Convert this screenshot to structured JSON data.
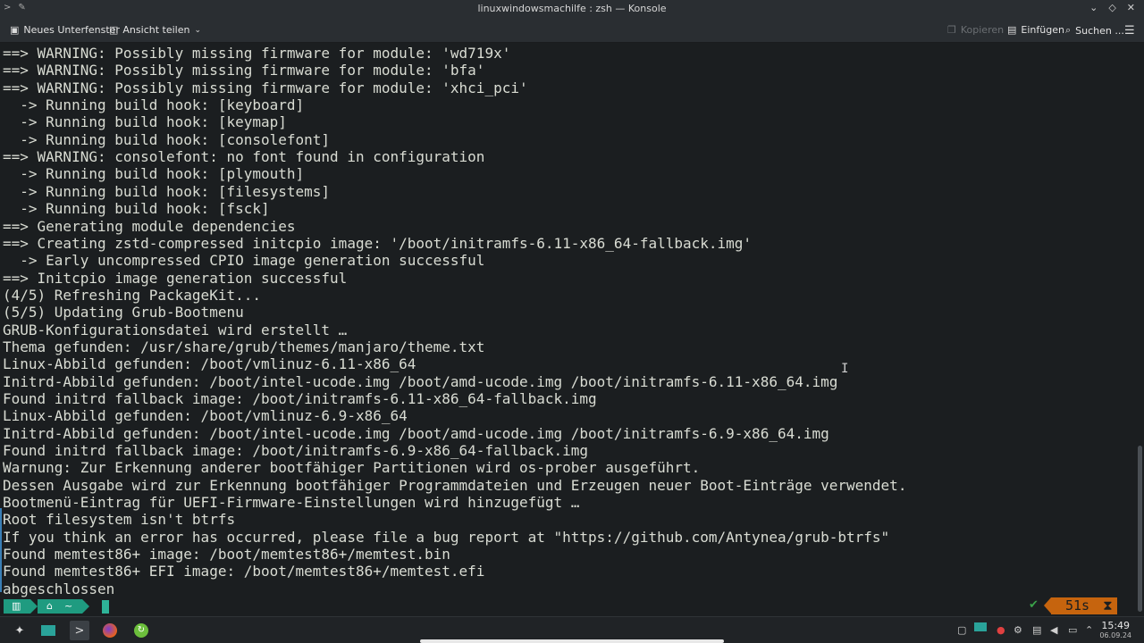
{
  "window": {
    "title": "linuxwindowsmachilfe : zsh — Konsole"
  },
  "toolbar": {
    "new_tab": "Neues Unterfenster",
    "split_view": "Ansicht teilen",
    "copy": "Kopieren",
    "paste": "Einfügen",
    "search": "Suchen ..."
  },
  "terminal": {
    "lines": [
      "==> WARNING: Possibly missing firmware for module: 'wd719x'",
      "==> WARNING: Possibly missing firmware for module: 'bfa'",
      "==> WARNING: Possibly missing firmware for module: 'xhci_pci'",
      "  -> Running build hook: [keyboard]",
      "  -> Running build hook: [keymap]",
      "  -> Running build hook: [consolefont]",
      "==> WARNING: consolefont: no font found in configuration",
      "  -> Running build hook: [plymouth]",
      "  -> Running build hook: [filesystems]",
      "  -> Running build hook: [fsck]",
      "==> Generating module dependencies",
      "==> Creating zstd-compressed initcpio image: '/boot/initramfs-6.11-x86_64-fallback.img'",
      "  -> Early uncompressed CPIO image generation successful",
      "==> Initcpio image generation successful",
      "(4/5) Refreshing PackageKit...",
      "(5/5) Updating Grub-Bootmenu",
      "GRUB-Konfigurationsdatei wird erstellt …",
      "Thema gefunden: /usr/share/grub/themes/manjaro/theme.txt",
      "Linux-Abbild gefunden: /boot/vmlinuz-6.11-x86_64",
      "Initrd-Abbild gefunden: /boot/intel-ucode.img /boot/amd-ucode.img /boot/initramfs-6.11-x86_64.img",
      "Found initrd fallback image: /boot/initramfs-6.11-x86_64-fallback.img",
      "Linux-Abbild gefunden: /boot/vmlinuz-6.9-x86_64",
      "Initrd-Abbild gefunden: /boot/intel-ucode.img /boot/amd-ucode.img /boot/initramfs-6.9-x86_64.img",
      "Found initrd fallback image: /boot/initramfs-6.9-x86_64-fallback.img",
      "Warnung: Zur Erkennung anderer bootfähiger Partitionen wird os-prober ausgeführt.",
      "Dessen Ausgabe wird zur Erkennung bootfähiger Programmdateien und Erzeugen neuer Boot-Einträge verwendet.",
      "Bootmenü-Eintrag für UEFI-Firmware-Einstellungen wird hinzugefügt …",
      "Root filesystem isn't btrfs",
      "If you think an error has occurred, please file a bug report at \"https://github.com/Antynea/grub-btrfs\"",
      "Found memtest86+ image: /boot/memtest86+/memtest.bin",
      "Found memtest86+ EFI image: /boot/memtest86+/memtest.efi",
      "abgeschlossen"
    ]
  },
  "prompt": {
    "status_check": "✔",
    "elapsed": "51s",
    "elapsed_icon": "hourglass-icon"
  },
  "taskbar": {
    "time": "15:49",
    "date": "06.09.24"
  },
  "colors": {
    "background": "#1b1e20",
    "text": "#d9dcd3",
    "prompt_teal": "#1f9b80",
    "timer_orange": "#c6640e",
    "check_green": "#3aa24a"
  }
}
